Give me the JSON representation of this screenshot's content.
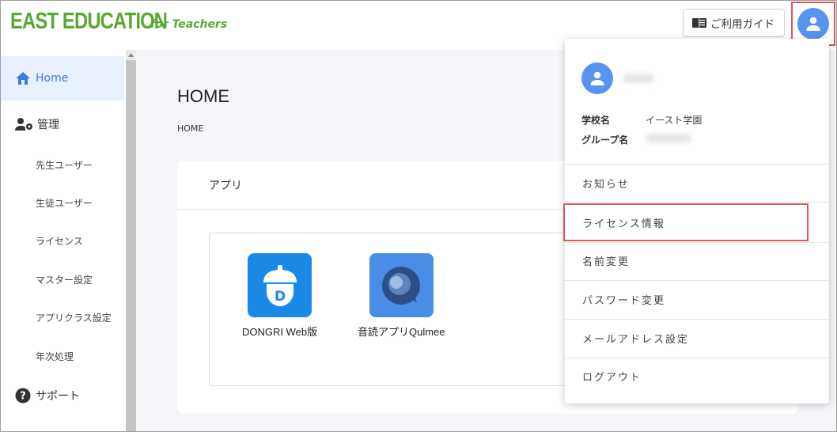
{
  "header": {
    "brand": "EAST EDUCATION",
    "brand_sub": "for Teachers",
    "guide_button": "ご利用ガイド"
  },
  "sidebar": {
    "home": "Home",
    "admin": "管理",
    "sub_items": [
      "先生ユーザー",
      "生徒ユーザー",
      "ライセンス",
      "マスター設定",
      "アプリクラス設定",
      "年次処理"
    ],
    "support": "サポート"
  },
  "main": {
    "title": "HOME",
    "breadcrumb": "HOME",
    "card_title": "アプリ",
    "apps": [
      {
        "label": "DONGRI Web版",
        "icon": "acorn-icon",
        "color": "#1a8ae6"
      },
      {
        "label": "音読アプリQulmee",
        "icon": "speech-icon",
        "color": "#4a8de6"
      }
    ]
  },
  "dropdown": {
    "school_label": "学校名",
    "school_value": "イースト学園",
    "group_label": "グループ名",
    "items": [
      "お知らせ",
      "ライセンス情報",
      "名前変更",
      "パスワード変更",
      "メールアドレス設定",
      "ログアウト"
    ]
  },
  "colors": {
    "brand": "#5aa832",
    "accent": "#3e7be0",
    "avatar": "#5794f0",
    "highlight": "#e05757"
  }
}
